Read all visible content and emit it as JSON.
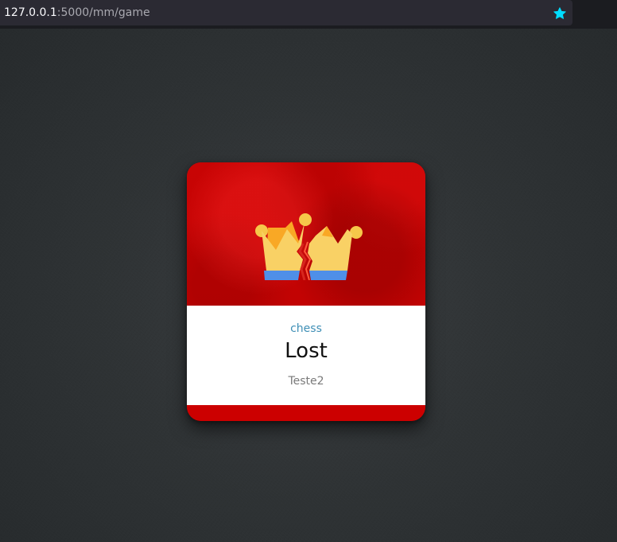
{
  "browser": {
    "url_host": "127.0.0.1",
    "url_rest": ":5000/mm/game",
    "bookmark_icon": "star-icon",
    "bookmark_color": "#00ddff"
  },
  "card": {
    "accent_color": "#cc0000",
    "icon": "broken-crown-icon",
    "game_name": "chess",
    "result": "Lost",
    "opponent": "Teste2"
  }
}
